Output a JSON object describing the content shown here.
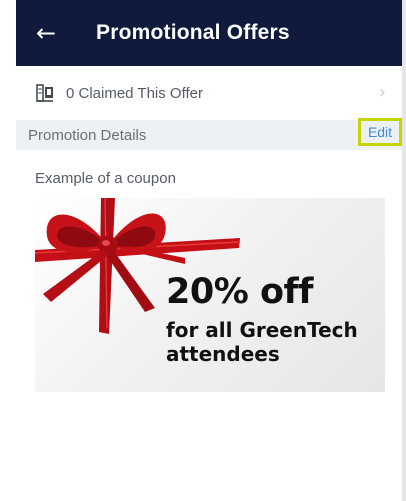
{
  "header": {
    "back_icon": "arrow-left-icon",
    "title": "Promotional Offers"
  },
  "claimed": {
    "icon": "claim-ticket-icon",
    "label": "0 Claimed This Offer",
    "chevron_icon": "chevron-right-icon"
  },
  "section": {
    "title": "Promotion Details",
    "edit_label": "Edit"
  },
  "content": {
    "example_text": "Example of a coupon",
    "coupon": {
      "headline": "20% off",
      "line1": "for all GreenTech",
      "line2": "attendees",
      "ribbon_color": "#c40f16"
    }
  },
  "colors": {
    "app_bar": "#0f1a3c",
    "edit_link": "#3a8fd6",
    "highlight": "#c6d400",
    "section_bg": "#eef1f4"
  }
}
